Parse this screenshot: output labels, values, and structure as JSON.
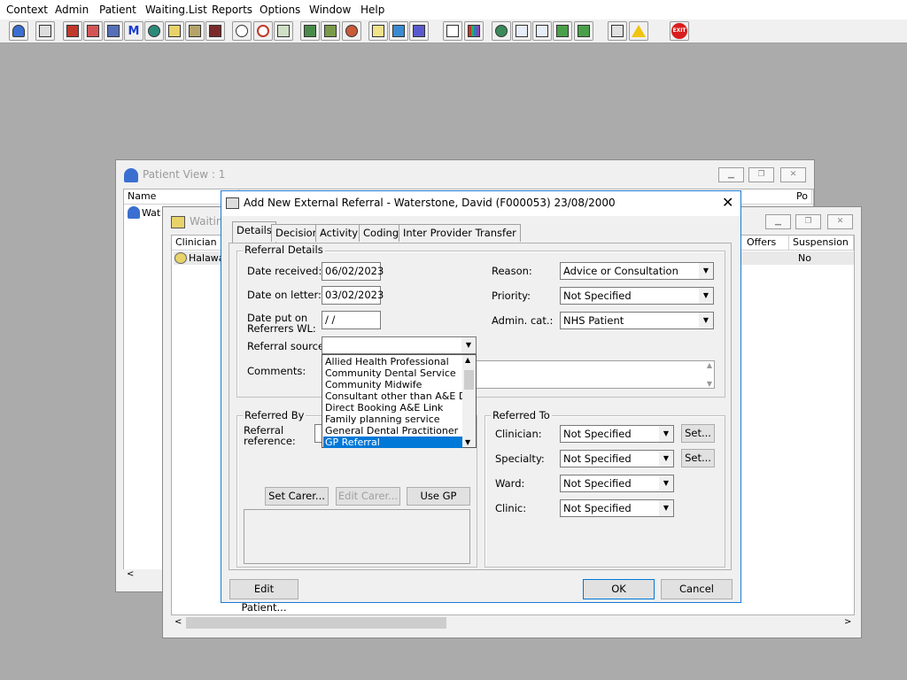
{
  "menu": [
    "Context",
    "Admin",
    "Patient",
    "Waiting.List",
    "Reports",
    "Options",
    "Window",
    "Help"
  ],
  "toolbar_icons": [
    "patient-icon",
    "print-icon",
    "book-icon",
    "edit-icon",
    "browse-icon",
    "m-icon",
    "person-icon",
    "note-icon",
    "letter-icon",
    "camera-icon",
    "search-icon",
    "clock-icon",
    "screen-icon",
    "gallery-icon",
    "report-icon",
    "dial-icon",
    "memo-icon",
    "bed-icon",
    "ward-icon",
    "document-icon",
    "chart-icon",
    "globe-icon",
    "check-icon",
    "check2-icon",
    "check3-icon",
    "check4-icon",
    "transfer-icon",
    "warning-icon",
    "exit-icon"
  ],
  "exit_label": "EXIT",
  "patient_view": {
    "title": "Patient View : 1",
    "col_name": "Name",
    "col_po": "Po",
    "row_name": "Wat"
  },
  "waiting_window": {
    "title": "Waiting",
    "col_clinician": "Clinician",
    "col_offers": "Offers",
    "col_suspension": "Suspension Pe",
    "row_clinician": "Halawa",
    "row_suspension": "No"
  },
  "dialog": {
    "title": "Add New External Referral - Waterstone, David (F000053) 23/08/2000",
    "tabs": [
      "Details",
      "Decision",
      "Activity",
      "Coding",
      "Inter Provider Transfer"
    ],
    "referral_details_label": "Referral Details",
    "date_received_label": "Date received:",
    "date_received": "06/02/2023",
    "date_on_letter_label": "Date on letter:",
    "date_on_letter": "03/02/2023",
    "date_put_label_1": "Date put on",
    "date_put_label_2": "Referrers WL:",
    "date_put_value": " /  /",
    "referral_source_label": "Referral source:",
    "referral_source_value": "",
    "comments_label": "Comments:",
    "reason_label": "Reason:",
    "reason_value": "Advice or Consultation",
    "priority_label": "Priority:",
    "priority_value": "Not Specified",
    "admin_cat_label": "Admin. cat.:",
    "admin_cat_value": "NHS Patient",
    "referral_source_options": [
      "Allied Health Professional",
      "Community Dental Service",
      "Community Midwife",
      "Consultant other than A&E Dept",
      "Direct Booking A&E Link",
      "Family planning service",
      "General Dental Practitioner",
      "GP Referral"
    ],
    "referral_source_selected": "GP Referral",
    "referred_by_label": "Referred By",
    "referral_reference_label_1": "Referral",
    "referral_reference_label_2": "reference:",
    "set_carer": "Set Carer...",
    "edit_carer": "Edit Carer...",
    "use_gp": "Use GP",
    "referred_to_label": "Referred To",
    "clinician_label": "Clinician:",
    "clinician_value": "Not Specified",
    "specialty_label": "Specialty:",
    "specialty_value": "Not Specified",
    "ward_label": "Ward:",
    "ward_value": "Not Specified",
    "clinic_label": "Clinic:",
    "clinic_value": "Not Specified",
    "set_label": "Set...",
    "edit_patient": "Edit Patient...",
    "ok": "OK",
    "cancel": "Cancel"
  },
  "colors": {
    "desktop": "#ababab",
    "selection": "#0078d7",
    "dialog_border": "#1a7ad4"
  }
}
